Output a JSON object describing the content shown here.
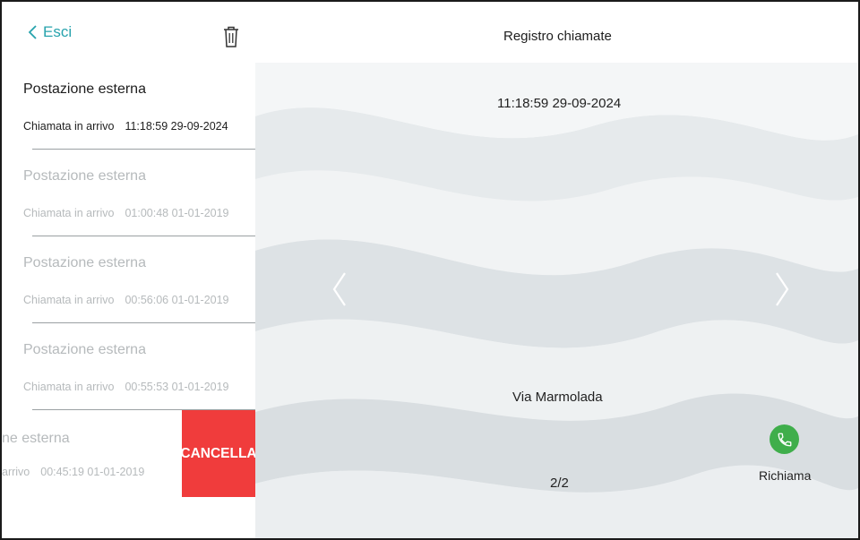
{
  "header": {
    "back_label": "Esci",
    "title": "Registro chiamate"
  },
  "call_log": [
    {
      "name": "Postazione esterna",
      "type": "Chiamata in arrivo",
      "time": "11:18:59 29-09-2024",
      "state": "active"
    },
    {
      "name": "Postazione esterna",
      "type": "Chiamata in arrivo",
      "time": "01:00:48 01-01-2019",
      "state": "faded"
    },
    {
      "name": "Postazione esterna",
      "type": "Chiamata in arrivo",
      "time": "00:56:06 01-01-2019",
      "state": "faded"
    },
    {
      "name": "Postazione esterna",
      "type": "Chiamata in arrivo",
      "time": "00:55:53 01-01-2019",
      "state": "faded"
    },
    {
      "name_visible": "ne esterna",
      "type_visible": "arrivo",
      "time": "00:45:19 01-01-2019",
      "state": "swiped",
      "delete_label": "CANCELLA"
    }
  ],
  "detail": {
    "timestamp": "11:18:59 29-09-2024",
    "caller": "Via Marmolada",
    "pager": "2/2",
    "callback_label": "Richiama"
  },
  "icons": {
    "back": "chevron-left-icon",
    "trash": "trash-icon",
    "prev": "chevron-left-icon",
    "next": "chevron-right-icon",
    "call": "phone-icon"
  },
  "colors": {
    "accent": "#27a3ad",
    "delete": "#f03c3c",
    "call": "#3fae4b"
  }
}
